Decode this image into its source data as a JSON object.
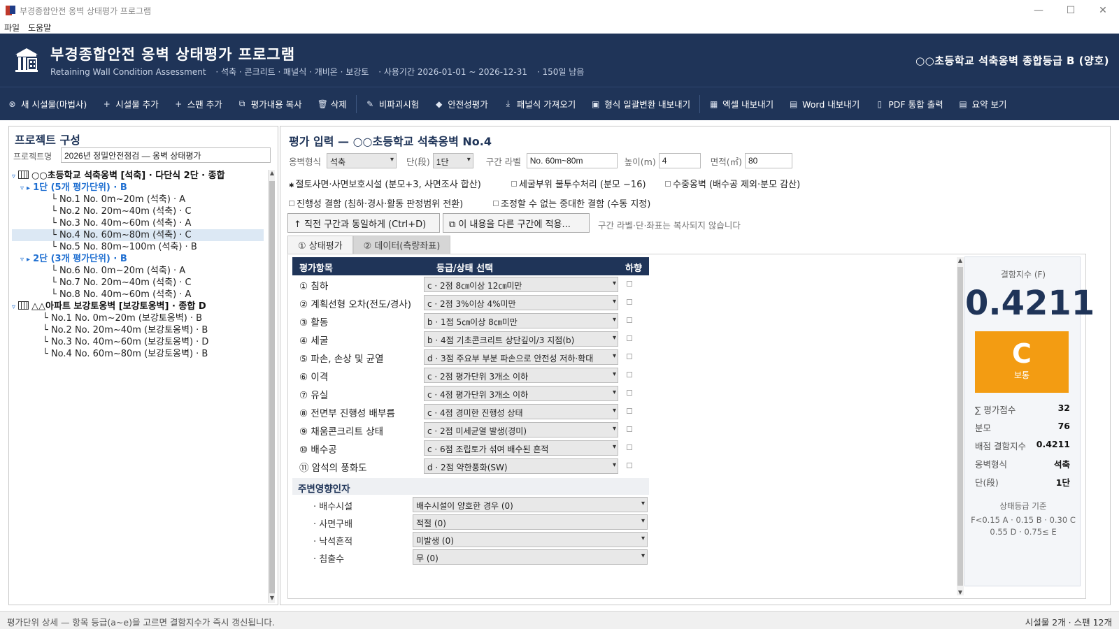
{
  "window": {
    "title": "부경종합안전 옹벽 상태평가 프로그램",
    "controls": [
      "—",
      "☐",
      "✕"
    ]
  },
  "menu": [
    "파일",
    "도움말"
  ],
  "header": {
    "title": "부경종합안전  옹벽 상태평가 프로그램",
    "subtitle": "Retaining Wall Condition Assessment",
    "types": "·  석축 · 콘크리트 · 패널식 · 개비온 · 보강토",
    "period": "·  사용기간 2026-01-01 ~ 2026-12-31",
    "remaining": "·  150일 남음",
    "summary": "○○초등학교 석축옹벽 종합등급  B (양호)"
  },
  "toolbar": [
    {
      "icon": "⊗",
      "icon_name": "new-facility-icon",
      "label": "새 시설물(마법사)"
    },
    {
      "icon": "+",
      "icon_name": "plus-icon",
      "label": "시설물 추가"
    },
    {
      "icon": "+",
      "icon_name": "plus-icon",
      "label": "스팬 추가"
    },
    {
      "icon": "⧉",
      "icon_name": "copy-icon",
      "label": "평가내용 복사"
    },
    {
      "icon": "🗑",
      "icon_name": "trash-icon",
      "label": "삭제"
    },
    {
      "icon": "✎",
      "icon_name": "hammer-icon",
      "label": "비파괴시험"
    },
    {
      "icon": "◆",
      "icon_name": "shield-icon",
      "label": "안전성평가"
    },
    {
      "icon": "⤓",
      "icon_name": "import-icon",
      "label": "패널식 가져오기"
    },
    {
      "icon": "▣",
      "icon_name": "batch-export-icon",
      "label": "형식 일괄변환 내보내기"
    },
    {
      "icon": "▦",
      "icon_name": "excel-icon",
      "label": "엑셀 내보내기"
    },
    {
      "icon": "▤",
      "icon_name": "word-icon",
      "label": "Word 내보내기"
    },
    {
      "icon": "▯",
      "icon_name": "pdf-icon",
      "label": "PDF 통합 출력"
    },
    {
      "icon": "▤",
      "icon_name": "summary-icon",
      "label": "요약 보기"
    }
  ],
  "left": {
    "title": "프로젝트 구성",
    "project_label": "프로젝트명",
    "project_name": "2026년 정밀안전점검 — 옹벽 상태평가",
    "tree": [
      {
        "text": "○○초등학교 석축옹벽 [석축] · 다단식 2단 · 종합",
        "kind": "facility",
        "indent": 0
      },
      {
        "text": "1단 (5개 평가단위) · B",
        "kind": "tier",
        "indent": 1
      },
      {
        "text": "└ No.1 No. 0m~20m (석축) · A",
        "kind": "unit",
        "indent": 2
      },
      {
        "text": "└ No.2 No. 20m~40m (석축) · C",
        "kind": "unit",
        "indent": 2
      },
      {
        "text": "└ No.3 No. 40m~60m (석축) · A",
        "kind": "unit",
        "indent": 2
      },
      {
        "text": "└ No.4 No. 60m~80m (석축) · C",
        "kind": "unit",
        "indent": 2,
        "selected": true
      },
      {
        "text": "└ No.5 No. 80m~100m (석축) · B",
        "kind": "unit",
        "indent": 2
      },
      {
        "text": "2단 (3개 평가단위) · B",
        "kind": "tier",
        "indent": 1
      },
      {
        "text": "└ No.6 No. 0m~20m (석축) · A",
        "kind": "unit",
        "indent": 2
      },
      {
        "text": "└ No.7 No. 20m~40m (석축) · C",
        "kind": "unit",
        "indent": 2
      },
      {
        "text": "└ No.8 No. 40m~60m (석축) · A",
        "kind": "unit",
        "indent": 2
      },
      {
        "text": "△△아파트 보강토옹벽 [보강토옹벽] · 종합 D",
        "kind": "facility",
        "indent": 0
      },
      {
        "text": "└ No.1 No. 0m~20m (보강토옹벽) · B",
        "kind": "unit",
        "indent": 1
      },
      {
        "text": "└ No.2 No. 20m~40m (보강토옹벽) · B",
        "kind": "unit",
        "indent": 1
      },
      {
        "text": "└ No.3 No. 40m~60m (보강토옹벽) · D",
        "kind": "unit",
        "indent": 1
      },
      {
        "text": "└ No.4 No. 60m~80m (보강토옹벽) · B",
        "kind": "unit",
        "indent": 1
      }
    ]
  },
  "main": {
    "title": "평가 입력 — ○○초등학교 석축옹벽  No.4",
    "fields": {
      "wall_type_label": "옹벽형식",
      "wall_type": "석축",
      "tier_label": "단(段)",
      "tier": "1단",
      "section_label": "구간 라벨",
      "section": "No. 60m~80m",
      "height_label": "높이(m)",
      "height": "4",
      "area_label": "면적(㎡)",
      "area": "80"
    },
    "checks": [
      {
        "label": "절토사면·사면보호시설 (분모+3, 사면조사 합산)",
        "checked": true
      },
      {
        "label": "세굴부위 불투수처리 (분모 −16)",
        "checked": false
      },
      {
        "label": "수중옹벽 (배수공 제외·분모 감산)",
        "checked": false
      },
      {
        "label": "진행성 결함 (침하·경사·활동 판정범위 전환)",
        "checked": false
      },
      {
        "label": "조정할 수 없는 중대한 결함 (수동 지정)",
        "checked": false
      }
    ],
    "btn_same": "↑ 직전 구간과 동일하게 (Ctrl+D)",
    "btn_apply": "⧉ 이 내용을 다른 구간에 적용...",
    "copy_note": "구간 라벨·단·좌표는 복사되지 않습니다",
    "tabs": [
      "① 상태평가",
      "② 데이터(측량좌표)"
    ],
    "table_headers": {
      "item": "평가항목",
      "grade": "등급/상태 선택",
      "down": "하향"
    },
    "items": [
      {
        "label": "① 침하",
        "value": "c · 2점  8㎝이상 12㎝미만"
      },
      {
        "label": "② 계획선형 오차(전도/경사)",
        "value": "c · 2점  3%이상 4%미만"
      },
      {
        "label": "③ 활동",
        "value": "b · 1점  5㎝이상 8㎝미만"
      },
      {
        "label": "④ 세굴",
        "value": "b · 4점  기초콘크리트 상단깊이/3 지점(b)"
      },
      {
        "label": "⑤ 파손, 손상 및 균열",
        "value": "d · 3점  주요부 부분 파손으로 안전성 저하·확대"
      },
      {
        "label": "⑥ 이격",
        "value": "c · 2점  평가단위 3개소 이하"
      },
      {
        "label": "⑦ 유실",
        "value": "c · 4점  평가단위 3개소 이하"
      },
      {
        "label": "⑧ 전면부 진행성 배부름",
        "value": "c · 4점  경미한 진행성 상태"
      },
      {
        "label": "⑨ 채움콘크리트 상태",
        "value": "c · 2점  미세균열 발생(경미)"
      },
      {
        "label": "⑩ 배수공",
        "value": "c · 6점  조립토가 섞여 배수된 흔적"
      },
      {
        "label": "⑪ 암석의 풍화도",
        "value": "d · 2점  약한풍화(SW)"
      }
    ],
    "env_title": "주변영향인자",
    "env": [
      {
        "label": "· 배수시설",
        "value": "배수시설이 양호한 경우 (0)"
      },
      {
        "label": "· 사면구배",
        "value": "적절 (0)"
      },
      {
        "label": "· 낙석흔적",
        "value": "미발생 (0)"
      },
      {
        "label": "· 침출수",
        "value": "무 (0)"
      }
    ]
  },
  "score": {
    "caption": "결함지수 (F)",
    "index": "0.4211",
    "grade": "C",
    "grade_label": "보통",
    "grade_color": "#f39c12",
    "rows": [
      {
        "k": "∑ 평가점수",
        "v": "32"
      },
      {
        "k": "분모",
        "v": "76"
      },
      {
        "k": "배점 결함지수",
        "v": "0.4211"
      },
      {
        "k": "옹벽형식",
        "v": "석축"
      },
      {
        "k": "단(段)",
        "v": "1단"
      }
    ],
    "std_title": "상태등급 기준",
    "std_line1": "F<0.15 A · 0.15 B · 0.30 C",
    "std_line2": "0.55 D · 0.75≤ E"
  },
  "status": {
    "left": "평가단위 상세 — 항목 등급(a~e)을 고르면 결함지수가 즉시 갱신됩니다.",
    "right": "시설물 2개 · 스팬 12개"
  }
}
